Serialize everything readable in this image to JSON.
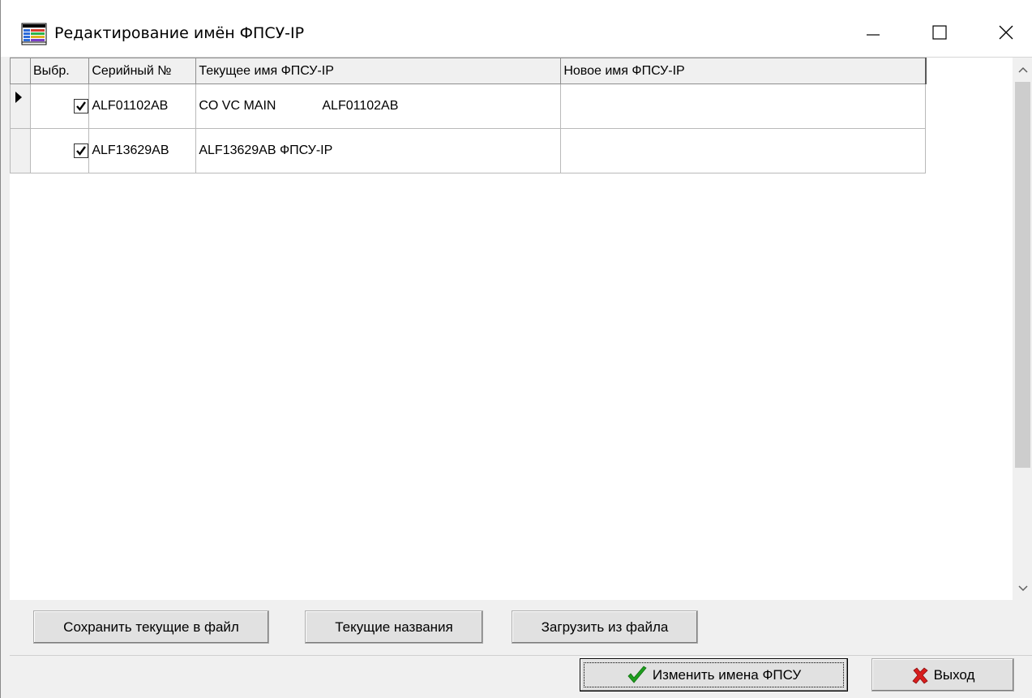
{
  "window": {
    "title": "Редактирование имён ФПСУ-IP"
  },
  "grid": {
    "columns": [
      "Выбр.",
      "Серийный №",
      "Текущее имя ФПСУ-IP",
      "Новое имя ФПСУ-IP"
    ],
    "rows": [
      {
        "selected": true,
        "current": true,
        "serial": "ALF01102AB",
        "current_name": "CO VC MAIN             ALF01102AB",
        "new_name": ""
      },
      {
        "selected": true,
        "current": false,
        "serial": "ALF13629AB",
        "current_name": "ALF13629AB ФПСУ-IP",
        "new_name": ""
      }
    ]
  },
  "buttons": {
    "save_to_file": "Сохранить текущие в файл",
    "current_names": "Текущие названия",
    "load_from_file": "Загрузить из файла",
    "apply": "Изменить имена ФПСУ",
    "exit": "Выход"
  },
  "colors": {
    "apply_icon": "#1e9e1e",
    "exit_icon": "#d81e1e"
  }
}
